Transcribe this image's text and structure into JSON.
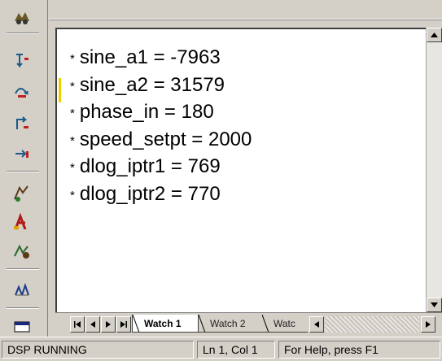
{
  "toolbar": {
    "icons": [
      "watch-icon",
      "step-into-icon",
      "step-over-icon",
      "step-out-icon",
      "run-icon",
      "halt-icon",
      "animate-icon",
      "profile-icon",
      "memory-window-icon"
    ]
  },
  "watch": {
    "variables": [
      {
        "marker": "*",
        "name": "sine_a1",
        "value": "-7963"
      },
      {
        "marker": "*",
        "name": "sine_a2",
        "value": "31579"
      },
      {
        "marker": "*",
        "name": "phase_in",
        "value": "180"
      },
      {
        "marker": "*",
        "name": "speed_setpt",
        "value": "2000"
      },
      {
        "marker": "*",
        "name": "dlog_iptr1",
        "value": "769"
      },
      {
        "marker": "*",
        "name": "dlog_iptr2",
        "value": "770"
      }
    ]
  },
  "tabs": [
    {
      "label": "Watch 1",
      "active": true
    },
    {
      "label": "Watch 2",
      "active": false
    },
    {
      "label": "Watc",
      "active": false
    }
  ],
  "status": {
    "state": "DSP RUNNING",
    "mode": "For Help, press F1",
    "position": "Ln 1, Col 1"
  },
  "colors": {
    "chrome": "#d4d0c8",
    "pane": "#ffffff",
    "marker": "#e6d200"
  }
}
